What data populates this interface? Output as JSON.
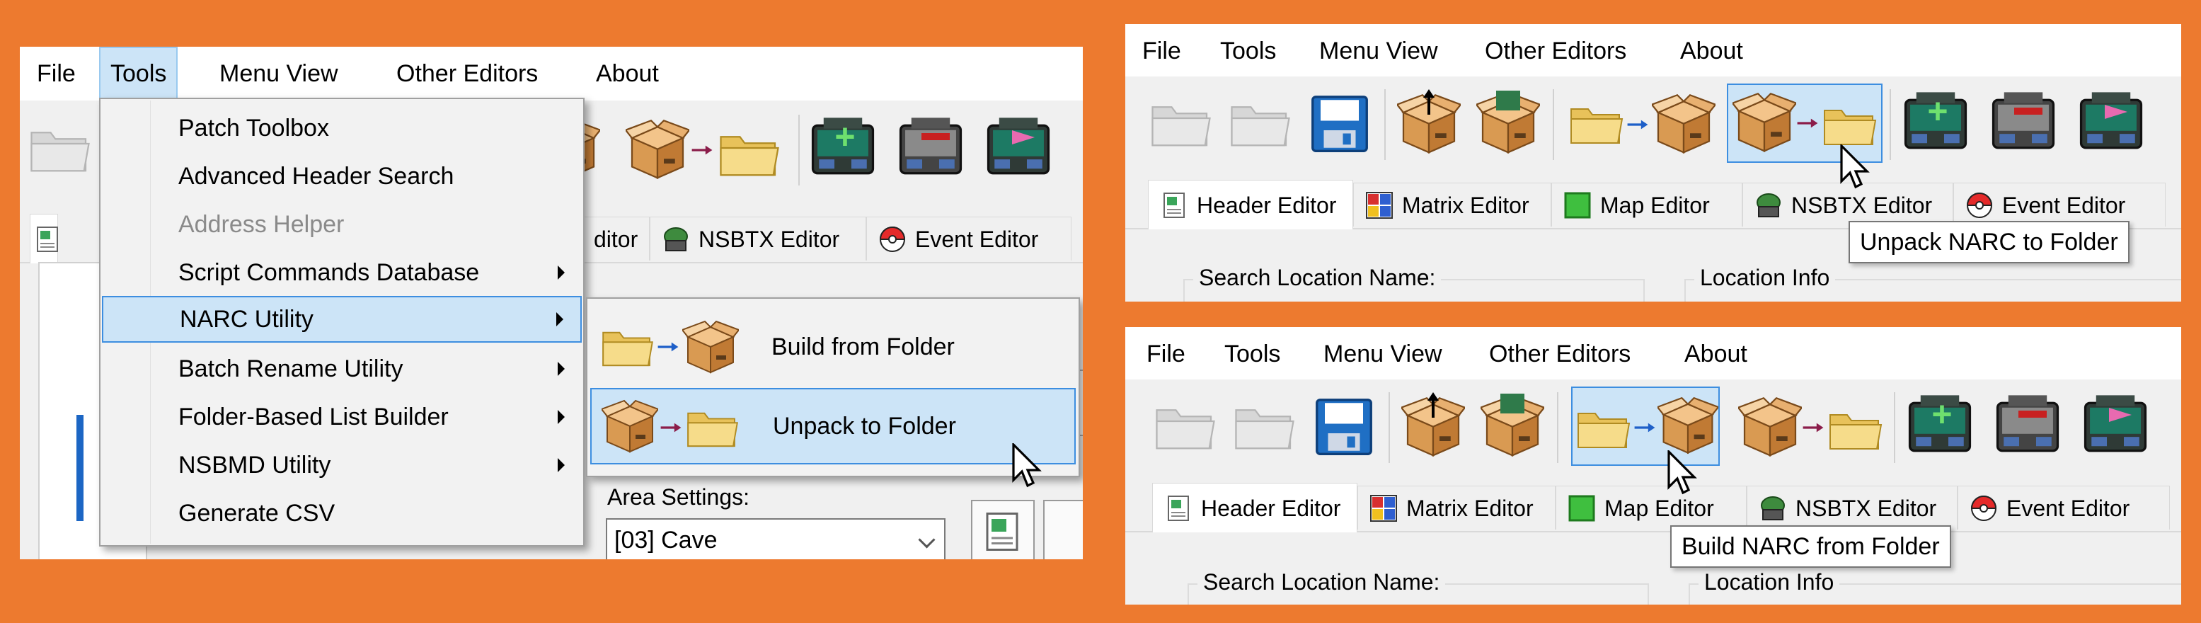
{
  "menu": {
    "file": "File",
    "tools": "Tools",
    "menu_view": "Menu View",
    "other_editors": "Other Editors",
    "about": "About"
  },
  "tools_menu": {
    "items": [
      {
        "label": "Patch Toolbox",
        "state": "normal"
      },
      {
        "label": "Advanced Header Search",
        "state": "normal"
      },
      {
        "label": "Address Helper",
        "state": "disabled"
      },
      {
        "label": "Script Commands Database",
        "state": "submenu"
      },
      {
        "label": "NARC Utility",
        "state": "highlighted-submenu"
      },
      {
        "label": "Batch Rename Utility",
        "state": "submenu"
      },
      {
        "label": "Folder-Based List Builder",
        "state": "submenu"
      },
      {
        "label": "NSBMD Utility",
        "state": "submenu"
      },
      {
        "label": "Generate CSV",
        "state": "normal"
      }
    ]
  },
  "narc_submenu": {
    "build": "Build from Folder",
    "unpack": "Unpack to Folder",
    "highlighted": "Unpack to Folder"
  },
  "tabs": {
    "header": "Header Editor",
    "matrix": "Matrix Editor",
    "map": "Map Editor",
    "nsbtx": "NSBTX Editor",
    "event": "Event Editor",
    "left_partial": "ditor"
  },
  "left_panel": {
    "area_settings_label": "Area Settings:",
    "area_value": "[03] Cave"
  },
  "fields": {
    "search_location": "Search Location Name:",
    "location_info": "Location Info"
  },
  "tooltips": {
    "unpack_narc": "Unpack NARC to Folder",
    "build_narc": "Build NARC from Folder"
  },
  "toolbar_icons": [
    "open-rom-icon",
    "open-folder-icon",
    "save-rom-icon",
    "unpack-rom-icon",
    "repack-rom-icon",
    "build-narc-icon",
    "unpack-narc-icon",
    "add-overworld-icon",
    "remove-overworld-icon",
    "export-overworld-icon"
  ],
  "colors": {
    "frame": "#ed7a2f",
    "highlight_fill": "#cce4f7",
    "highlight_border": "#3d8ee0"
  }
}
